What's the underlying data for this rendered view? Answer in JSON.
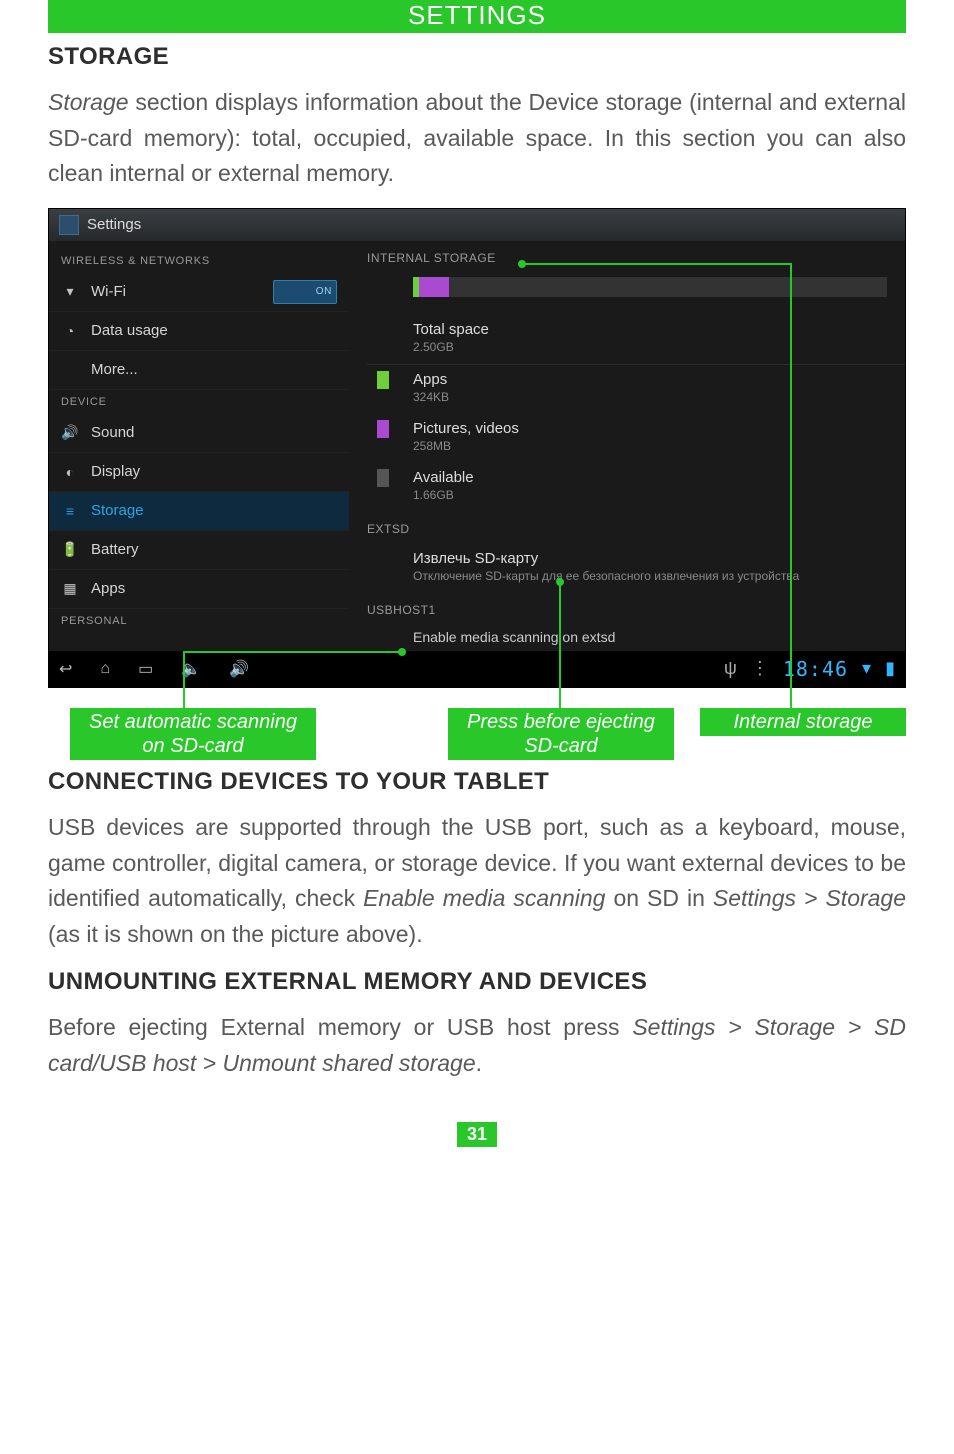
{
  "header": {
    "title": "SETTINGS"
  },
  "sec_storage": {
    "heading": "STORAGE",
    "p1_lead": "Storage",
    "p1_rest": " section displays information about the Device storage (internal and external SD-card memory): total, occupied, available space. In this section you can also clean internal or external memory."
  },
  "screenshot": {
    "window_title": "Settings",
    "left": {
      "cat1": "WIRELESS & NETWORKS",
      "wifi": "Wi-Fi",
      "wifi_toggle": "ON",
      "data_usage": "Data usage",
      "more": "More...",
      "cat2": "DEVICE",
      "sound": "Sound",
      "display": "Display",
      "storage": "Storage",
      "battery": "Battery",
      "apps": "Apps",
      "cat3": "PERSONAL"
    },
    "right": {
      "internal_hdr": "INTERNAL STORAGE",
      "total_lbl": "Total space",
      "total_val": "2.50GB",
      "apps_lbl": "Apps",
      "apps_val": "324KB",
      "pics_lbl": "Pictures, videos",
      "pics_val": "258MB",
      "avail_lbl": "Available",
      "avail_val": "1.66GB",
      "extsd_hdr": "EXTSD",
      "eject_lbl": "Извлечь SD-карту",
      "eject_sub": "Отключение SD-карты для ее безопасного извлечения из устройства",
      "usbhost_hdr": "USBHOST1",
      "enable_lbl": "Enable media scanning on extsd"
    },
    "navbar": {
      "time": "18:46"
    }
  },
  "callouts": {
    "c1": "Set automatic scanning on SD-card",
    "c2": "Press before ejecting SD-card",
    "c3": "Internal storage"
  },
  "sec_connect": {
    "heading": "CONNECTING DEVICES TO YOUR TABLET",
    "p1a": "USB devices are supported through the USB port, such as a keyboard, mouse, game controller, digital camera, or storage device. If you want external devices to be identified automatically, check ",
    "p1b_i": "Enable media scanning",
    "p1c": " on SD in ",
    "p1d_i": "Settings > Storage",
    "p1e": " (as it is shown on the picture above)."
  },
  "sec_unmount": {
    "heading": "UNMOUNTING EXTERNAL MEMORY AND DEVICES",
    "p1a": "Before ejecting External memory or USB host press ",
    "p1b_i": "Settings > Storage > SD card/USB host > Unmount shared storage",
    "p1c": "."
  },
  "page_number": "31"
}
